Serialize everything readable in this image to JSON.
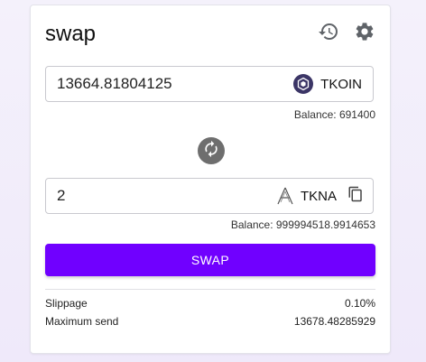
{
  "header": {
    "title": "swap"
  },
  "icons": {
    "history": "history-icon",
    "settings": "gear-icon",
    "swap_direction": "swap-arrows-icon",
    "copy": "copy-icon"
  },
  "from": {
    "amount": "13664.81804125",
    "token_symbol": "TKOIN",
    "balance_text": "Balance: 691400"
  },
  "to": {
    "amount": "2",
    "token_symbol": "TKNA",
    "balance_text": "Balance: 999994518.9914653"
  },
  "actions": {
    "swap_label": "SWAP"
  },
  "details": {
    "slippage_label": "Slippage",
    "slippage_value": "0.10%",
    "max_send_label": "Maximum send",
    "max_send_value": "13678.48285929"
  },
  "colors": {
    "primary": "#7000ff",
    "swap_direction_bg": "#6e6e6e",
    "tkoin_logo": "#3b3566"
  }
}
